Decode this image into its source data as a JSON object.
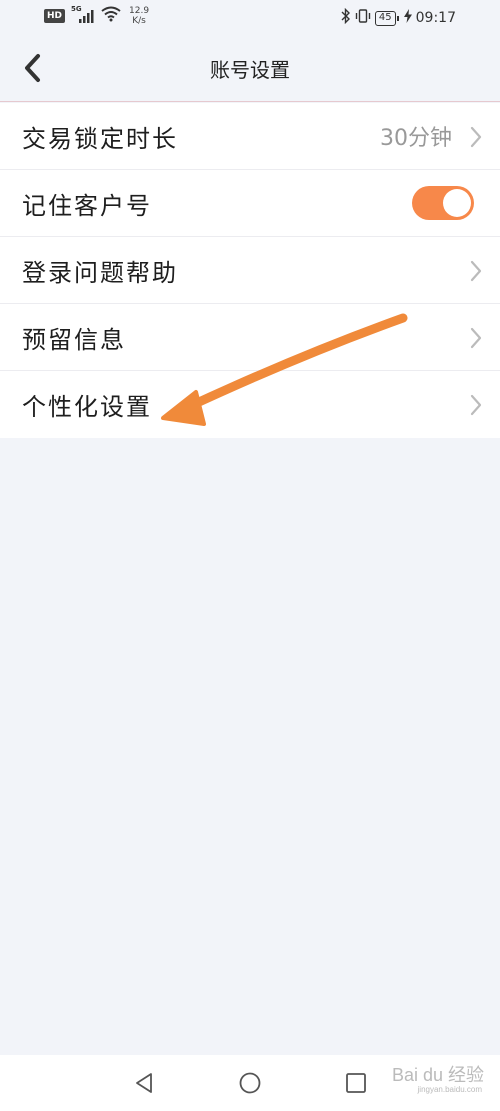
{
  "status_bar": {
    "hd": "HD",
    "network": "5G",
    "speed_value": "12.9",
    "speed_unit": "K/s",
    "battery": "45",
    "time": "09:17"
  },
  "header": {
    "title": "账号设置",
    "back_icon": "chevron-left-icon"
  },
  "settings": {
    "items": [
      {
        "label": "交易锁定时长",
        "value": "30分钟",
        "control": "chevron"
      },
      {
        "label": "记住客户号",
        "control": "toggle",
        "toggle_on": true
      },
      {
        "label": "登录问题帮助",
        "control": "chevron"
      },
      {
        "label": "预留信息",
        "control": "chevron"
      },
      {
        "label": "个性化设置",
        "control": "chevron"
      }
    ]
  },
  "colors": {
    "background": "#f2f4f9",
    "toggle_on": "#f7884a",
    "annotation_arrow": "#f08a3a"
  },
  "system_nav": {
    "icons": [
      "back-triangle-icon",
      "home-circle-icon",
      "recents-square-icon"
    ]
  },
  "watermark": {
    "text": "Bai du 经验",
    "sub": "jingyan.baidu.com"
  }
}
